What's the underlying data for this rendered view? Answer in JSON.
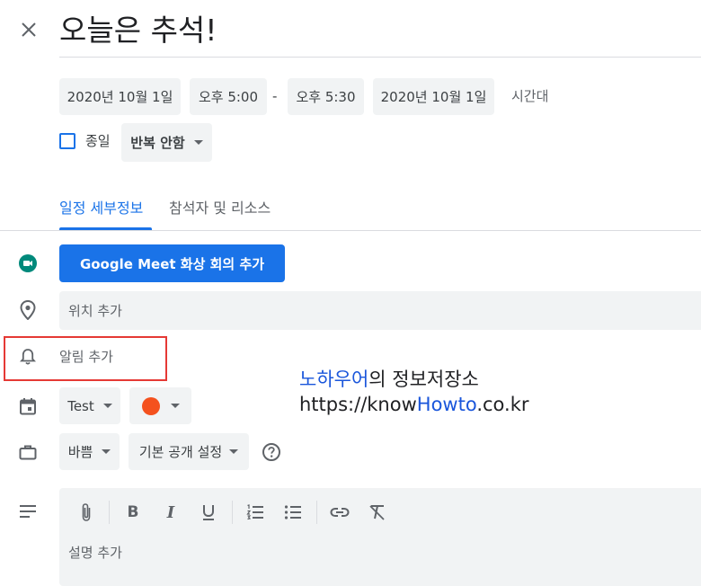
{
  "header": {
    "close_icon": "close-icon",
    "title": "오늘은 추석!"
  },
  "datetime": {
    "start_date": "2020년 10월 1일",
    "start_time": "오후 5:00",
    "separator": "-",
    "end_time": "오후 5:30",
    "end_date": "2020년 10월 1일",
    "timezone_label": "시간대"
  },
  "all_day": {
    "label": "종일",
    "checked": false
  },
  "repeat": {
    "selected": "반복 안함"
  },
  "tabs": [
    {
      "label": "일정 세부정보",
      "active": true
    },
    {
      "label": "참석자 및 리소스",
      "active": false
    }
  ],
  "meet": {
    "button_label": "Google Meet 화상 회의 추가",
    "icon": "google-meet-icon",
    "accent": "#1a73e8"
  },
  "location": {
    "placeholder": "위치 추가",
    "icon": "location-pin-icon"
  },
  "notification": {
    "label": "알림 추가",
    "icon": "bell-icon",
    "highlight_color": "#e53935"
  },
  "calendar": {
    "selected": "Test",
    "color": "#f4511e",
    "icon": "calendar-icon"
  },
  "availability": {
    "busy_selected": "바쁨",
    "visibility_selected": "기본 공개 설정",
    "help_icon": "help-icon",
    "icon": "briefcase-icon"
  },
  "description": {
    "placeholder": "설명 추가",
    "icon": "description-icon",
    "toolbar": [
      "attach-icon",
      "bold-icon",
      "italic-icon",
      "underline-icon",
      "numbered-list-icon",
      "bulleted-list-icon",
      "link-icon",
      "clear-format-icon"
    ]
  },
  "watermark": {
    "brand_blue": "노하우어",
    "brand_rest": "의 정보저장소",
    "url_pre": "https://know",
    "url_blue": "Howto",
    "url_post": ".co.kr",
    "blue_color": "#1a56db"
  }
}
